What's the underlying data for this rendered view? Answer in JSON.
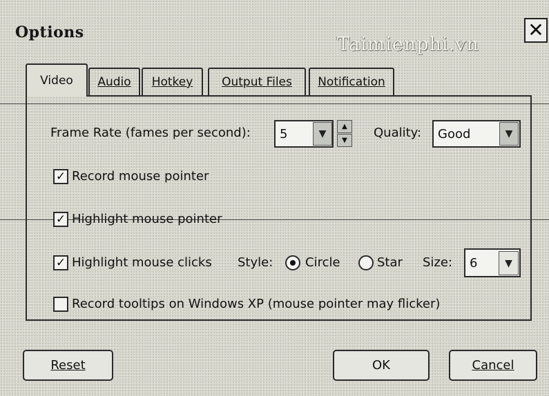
{
  "window": {
    "title": "Options",
    "watermark": "Taimienphi.vn",
    "close_glyph": "✕"
  },
  "tabs": [
    {
      "label": "Video",
      "active": true
    },
    {
      "label": "Audio",
      "active": false
    },
    {
      "label": "Hotkey",
      "active": false
    },
    {
      "label": "Output Files",
      "active": false
    },
    {
      "label": "Notification",
      "active": false
    }
  ],
  "video": {
    "frame_rate_label": "Frame Rate (fames per second):",
    "frame_rate_value": "5",
    "quality_label": "Quality:",
    "quality_value": "Good",
    "record_mouse_pointer": {
      "label": "Record mouse pointer",
      "checked": true
    },
    "highlight_mouse_pointer": {
      "label": "Highlight mouse pointer",
      "checked": true
    },
    "highlight_mouse_clicks": {
      "label": "Highlight mouse clicks",
      "checked": true
    },
    "style_label": "Style:",
    "style_options": [
      {
        "label": "Circle",
        "selected": true
      },
      {
        "label": "Star",
        "selected": false
      }
    ],
    "size_label": "Size:",
    "size_value": "6",
    "record_tooltips": {
      "label": "Record tooltips on Windows XP (mouse pointer may flicker)",
      "checked": false
    }
  },
  "buttons": {
    "reset": "Reset",
    "ok": "OK",
    "cancel": "Cancel"
  },
  "icons": {
    "check": "✓",
    "dropdown": "▼",
    "spin_up": "▲",
    "spin_down": "▼"
  }
}
